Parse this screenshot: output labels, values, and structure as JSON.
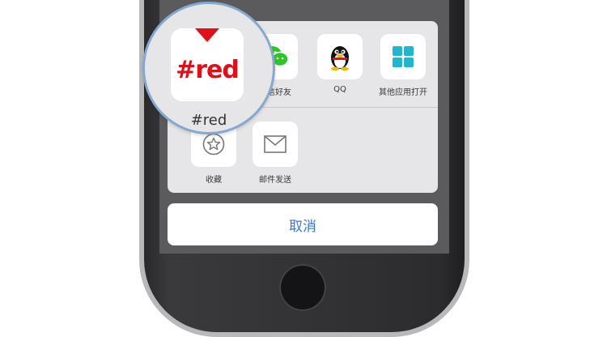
{
  "share_sheet": {
    "row1": [
      {
        "label": "微信好友",
        "icon": "wechat-icon"
      },
      {
        "label": "QQ",
        "icon": "qq-penguin-icon"
      },
      {
        "label": "其他应用打开",
        "icon": "grid-apps-icon"
      }
    ],
    "row2": [
      {
        "label": "收藏",
        "icon": "star-icon"
      },
      {
        "label": "邮件发送",
        "icon": "mail-icon"
      }
    ]
  },
  "magnifier": {
    "app_name": "#red",
    "logo_text": "#red"
  },
  "cancel_label": "取消",
  "colors": {
    "accent_blue": "#3478d4",
    "brand_red": "#e0101a",
    "wechat_green": "#31c42a",
    "apps_teal": "#1fb7cf"
  }
}
